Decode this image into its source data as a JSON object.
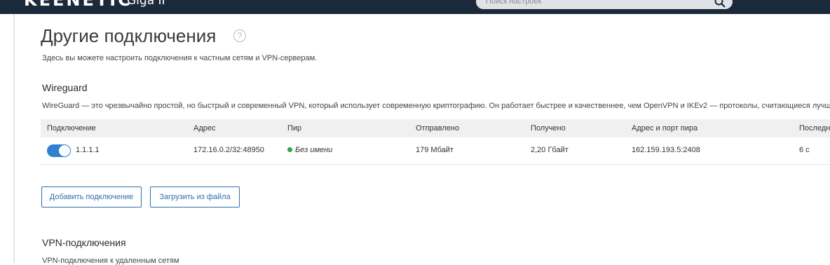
{
  "header": {
    "brand": "KEENETIC",
    "model": "Giga II",
    "search_placeholder": "Поиск настроек"
  },
  "page": {
    "title": "Другие подключения",
    "subtitle": "Здесь вы можете настроить подключения к частным сетям и VPN-серверам."
  },
  "wireguard": {
    "title": "Wireguard",
    "description": "WireGuard — это чрезвычайно простой, но быстрый и современный VPN, который использует современную криптографию. Он работает быстрее и качественнее, чем OpenVPN и IKEv2 — протоколы, считающиеся лучшими на се",
    "columns": [
      "Подключение",
      "Адрес",
      "Пир",
      "Отправлено",
      "Получено",
      "Адрес и порт пира",
      "Последн"
    ],
    "rows": [
      {
        "enabled": true,
        "name": "1.1.1.1",
        "address": "172.16.0.2/32:48950",
        "peer": "Без имени",
        "peer_status_color": "#2aa845",
        "sent": "179 Мбайт",
        "received": "2,20 Гбайт",
        "peer_address": "162.159.193.5:2408",
        "last": "6 с"
      }
    ],
    "add_button": "Добавить подключение",
    "upload_button": "Загрузить из файла"
  },
  "vpn": {
    "title": "VPN-подключения",
    "description": "VPN-подключения к удаленным сетям"
  },
  "colors": {
    "header_bg": "#1b2a3a",
    "accent": "#2f80d1",
    "button_border": "#2f6fb1"
  }
}
